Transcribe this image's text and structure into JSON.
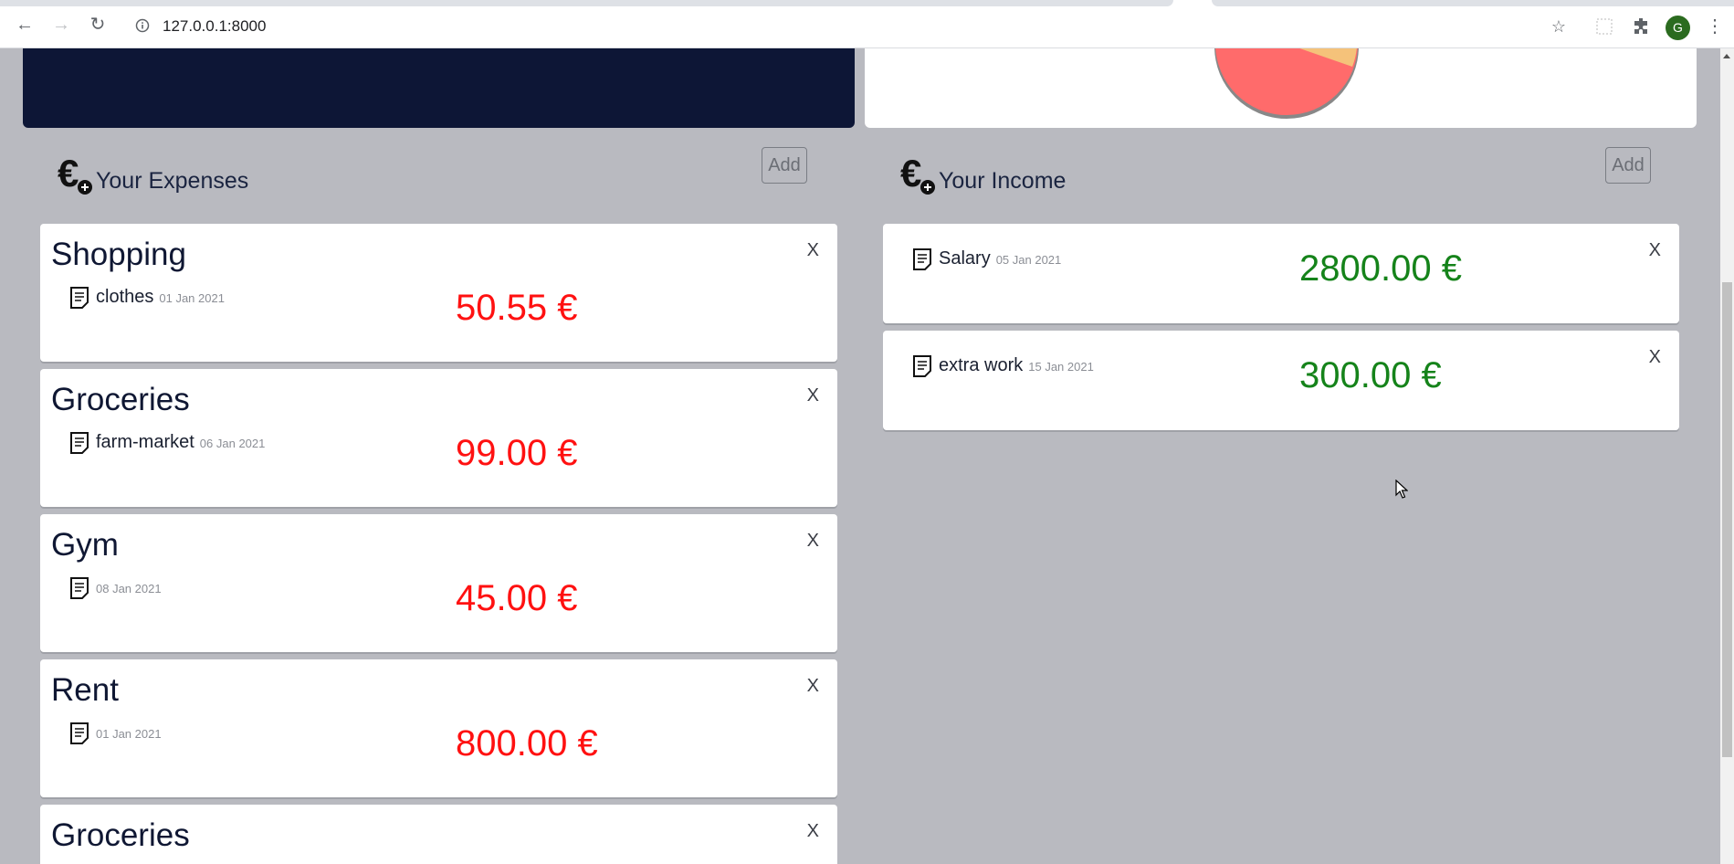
{
  "browser": {
    "url": "127.0.0.1:8000",
    "profile_initial": "G"
  },
  "expenses": {
    "title": "Your Expenses",
    "add_label": "Add",
    "items": [
      {
        "category": "Shopping",
        "description": "clothes",
        "date": "01 Jan 2021",
        "amount": "50.55 €",
        "close": "X"
      },
      {
        "category": "Groceries",
        "description": "farm-market",
        "date": "06 Jan 2021",
        "amount": "99.00 €",
        "close": "X"
      },
      {
        "category": "Gym",
        "description": "",
        "date": "08 Jan 2021",
        "amount": "45.00 €",
        "close": "X"
      },
      {
        "category": "Rent",
        "description": "",
        "date": "01 Jan 2021",
        "amount": "800.00 €",
        "close": "X"
      },
      {
        "category": "Groceries",
        "close": "X"
      }
    ]
  },
  "income": {
    "title": "Your Income",
    "add_label": "Add",
    "items": [
      {
        "description": "Salary",
        "date": "05 Jan 2021",
        "amount": "2800.00 €",
        "close": "X"
      },
      {
        "description": "extra work",
        "date": "15 Jan 2021",
        "amount": "300.00 €",
        "close": "X"
      }
    ]
  },
  "colors": {
    "expense_amount": "#ff1111",
    "income_amount": "#15831a",
    "dark_panel": "#0d1636",
    "background": "#b9bac0"
  }
}
